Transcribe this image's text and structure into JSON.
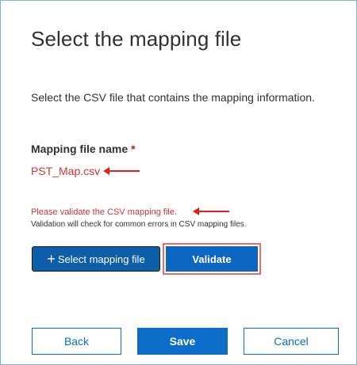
{
  "dialog": {
    "title": "Select the mapping file",
    "description": "Select the CSV file that contains the mapping information."
  },
  "mapping_field": {
    "label": "Mapping file name",
    "required_marker": "*",
    "file_name": "PST_Map.csv"
  },
  "validation": {
    "error_message": "Please validate the CSV mapping file.",
    "help_text": "Validation will check for common errors in CSV mapping files."
  },
  "actions": {
    "select_icon": "plus-icon",
    "select_label": "Select mapping file",
    "validate_label": "Validate"
  },
  "footer": {
    "back_label": "Back",
    "save_label": "Save",
    "cancel_label": "Cancel"
  },
  "colors": {
    "primary": "#0c6ec8",
    "error": "#d13438",
    "annotation": "#e0201f"
  }
}
